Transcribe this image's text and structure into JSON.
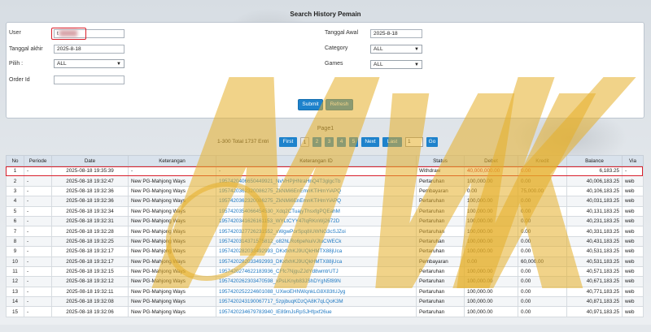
{
  "title": "Search History Pemain",
  "form": {
    "user_label": "User",
    "user_value": "t",
    "tgl_akhir_label": "Tanggal akhir",
    "tgl_akhir_value": "2025-8-18",
    "pilih_label": "Pilih :",
    "pilih_value": "ALL",
    "order_label": "Order Id",
    "order_value": "",
    "tgl_awal_label": "Tanggal Awal",
    "tgl_awal_value": "2025-8-18",
    "category_label": "Category",
    "category_value": "ALL",
    "games_label": "Games",
    "games_value": "ALL",
    "submit_label": "Submit",
    "refresh_label": "Refresh"
  },
  "pagination": {
    "page_label": "Page1",
    "info": "1-300 Total 1737 Entri",
    "first": "First",
    "pages": [
      "1",
      "2",
      "3",
      "4",
      "5"
    ],
    "next": "Next",
    "last": "Last",
    "input_value": "1",
    "go": "Go"
  },
  "table": {
    "headers": [
      "No",
      "Periode",
      "Date",
      "Keterangan",
      "Keterangan ID",
      "Status",
      "Debet",
      "Kredit",
      "Balance",
      "Via"
    ],
    "rows": [
      [
        "1",
        "-",
        "2025-08-18 19:35:39",
        "-",
        "-",
        "Withdraw",
        "40,000,000.00",
        "0.00",
        "6,183.25",
        "-"
      ],
      [
        "2",
        "-",
        "2025-08-18 19:32:47",
        "New PG-Mahjong Ways",
        "1957420406650449921_NvVHPjHNraHnQ4T3glgcTb",
        "Pertaruhan",
        "100,000.00",
        "0.00",
        "40,006,183.25",
        "web"
      ],
      [
        "3",
        "-",
        "2025-08-18 19:32:36",
        "New PG-Mahjong Ways",
        "1957420362320086275_ZkNMi6EnEmnKTiHmYiAPQ",
        "Pembayaran",
        "0.00",
        "75,000.00",
        "40,106,183.25",
        "web"
      ],
      [
        "4",
        "-",
        "2025-08-18 19:32:36",
        "New PG-Mahjong Ways",
        "1957420362320086275_ZkNMi6EnEmnKTiHmYiAPQ",
        "Pertaruhan",
        "100,000.00",
        "0.00",
        "40,031,183.25",
        "web"
      ],
      [
        "5",
        "-",
        "2025-08-18 19:32:34",
        "New PG-Mahjong Ways",
        "1957420354066454530_Xdq2CTuajyThsxfgPQEahM",
        "Pertaruhan",
        "100,000.00",
        "0.00",
        "40,131,183.25",
        "web"
      ],
      [
        "6",
        "-",
        "2025-08-18 19:32:31",
        "New PG-Mahjong Ways",
        "1957420341626161153_WYLtCYY47IqRKnWj2672D",
        "Pertaruhan",
        "100,000.00",
        "0.00",
        "40,231,183.25",
        "web"
      ],
      [
        "7",
        "-",
        "2025-08-18 19:32:28",
        "New PG-Mahjong Ways",
        "1957420327726231552_xWgwPorSpq8iUWNG3cSJZoi",
        "Pertaruhan",
        "100,000.00",
        "0.00",
        "40,331,183.25",
        "web"
      ],
      [
        "8",
        "-",
        "2025-08-18 19:32:25",
        "New PG-Mahjong Ways",
        "1957420314371575812_o82hLRo6peNuiVJtuCWECk",
        "Pertaruhan",
        "100,000.00",
        "0.00",
        "40,431,183.25",
        "web"
      ],
      [
        "9",
        "-",
        "2025-08-18 19:32:17",
        "New PG-Mahjong Ways",
        "1957420282033492993_DKxfxhKJ9UQkHMTX88jUca",
        "Pertaruhan",
        "100,000.00",
        "0.00",
        "40,531,183.25",
        "web"
      ],
      [
        "10",
        "-",
        "2025-08-18 19:32:17",
        "New PG-Mahjong Ways",
        "1957420282033492993_DKxfxhKJ9UQkHMTX88jUca",
        "Pembayaran",
        "0.00",
        "60,000.00",
        "40,531,183.25",
        "web"
      ],
      [
        "11",
        "-",
        "2025-08-18 19:32:15",
        "New PG-Mahjong Ways",
        "1957420274622183936_CFfc7NjguZJdYd8wmtrUTJ",
        "Pertaruhan",
        "100,000.00",
        "0.00",
        "40,571,183.25",
        "web"
      ],
      [
        "12",
        "-",
        "2025-08-18 19:32:12",
        "New PG-Mahjong Ways",
        "1957420262303470598_xPsLKnyb83JShDYgN5f89N",
        "Pertaruhan",
        "100,000.00",
        "0.00",
        "40,671,183.25",
        "web"
      ],
      [
        "13",
        "-",
        "2025-08-18 19:32:11",
        "New PG-Mahjong Ways",
        "1957420252224601088_UXwoEHNWqnkLG8X83tUJyg",
        "Pertaruhan",
        "100,000.00",
        "0.00",
        "40,771,183.25",
        "web"
      ],
      [
        "14",
        "-",
        "2025-08-18 19:32:08",
        "New PG-Mahjong Ways",
        "1957420243190067717_5zpjbuqKDzQA8K7qLQoK3M",
        "Pertaruhan",
        "100,000.00",
        "0.00",
        "40,871,183.25",
        "web"
      ],
      [
        "15",
        "-",
        "2025-08-18 19:32:06",
        "New PG-Mahjong Ways",
        "1957420234679783940_IE89mJsRpSJHfpxf26ue",
        "Pertaruhan",
        "100,000.00",
        "0.00",
        "40,971,183.25",
        "web"
      ]
    ]
  },
  "watermark_text": "MWK",
  "colors": {
    "primary": "#1e82cc",
    "highlight": "#d9202c",
    "link": "#1e78c2",
    "watermark": "#e6af28"
  }
}
